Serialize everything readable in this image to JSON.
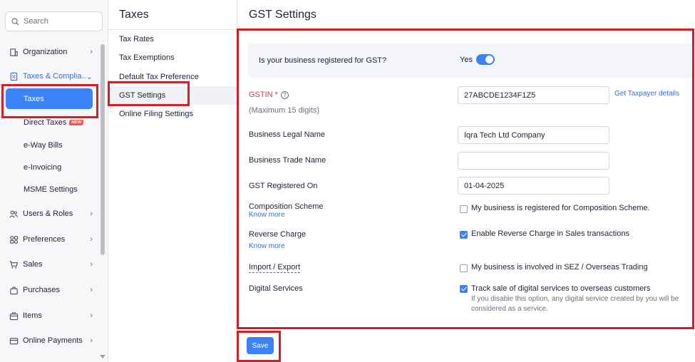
{
  "sidebar": {
    "search_placeholder": "Search",
    "items": [
      {
        "label": "Organization",
        "icon": "building-icon"
      },
      {
        "label": "Taxes & Complia...",
        "icon": "tax-document-icon"
      },
      {
        "label": "Users & Roles",
        "icon": "users-icon"
      },
      {
        "label": "Preferences",
        "icon": "preferences-icon"
      },
      {
        "label": "Sales",
        "icon": "cart-icon"
      },
      {
        "label": "Purchases",
        "icon": "bag-icon"
      },
      {
        "label": "Items",
        "icon": "box-icon"
      },
      {
        "label": "Online Payments",
        "icon": "card-icon"
      }
    ],
    "sub_items": [
      {
        "label": "Taxes"
      },
      {
        "label": "Direct Taxes",
        "badge": "NEW"
      },
      {
        "label": "e-Way Bills"
      },
      {
        "label": "e-Invoicing"
      },
      {
        "label": "MSME Settings"
      }
    ]
  },
  "taxes_menu": {
    "title": "Taxes",
    "items": [
      "Tax Rates",
      "Tax Exemptions",
      "Default Tax Preference",
      "GST Settings",
      "Online Filing Settings"
    ]
  },
  "main": {
    "title": "GST Settings",
    "registered_question": "Is your business registered for GST?",
    "registered_value": "Yes",
    "gstin": {
      "label": "GSTIN *",
      "hint": "(Maximum 15 digits)",
      "value": "27ABCDE1234F1Z5",
      "link": "Get Taxpayer details"
    },
    "legal_name": {
      "label": "Business Legal Name",
      "value": "Iqra Tech Ltd Company"
    },
    "trade_name": {
      "label": "Business Trade Name",
      "value": ""
    },
    "registered_on": {
      "label": "GST Registered On",
      "value": "01-04-2025"
    },
    "composition": {
      "label": "Composition Scheme",
      "link": "Know more",
      "checkbox_label": "My business is registered for Composition Scheme.",
      "checked": false
    },
    "reverse_charge": {
      "label": "Reverse Charge",
      "link": "Know more",
      "checkbox_label": "Enable Reverse Charge in Sales transactions",
      "checked": true
    },
    "import_export": {
      "label": "Import / Export",
      "checkbox_label": "My business is involved in SEZ / Overseas Trading",
      "checked": false
    },
    "digital_services": {
      "label": "Digital Services",
      "checkbox_label": "Track sale of digital services to overseas customers",
      "help": "If you disable this option, any digital service created by you will be considered as a service.",
      "checked": true
    },
    "save_label": "Save"
  },
  "colors": {
    "accent": "#3b82f6",
    "link": "#2f6fd8",
    "required": "#d94040",
    "highlight": "#d11f26"
  }
}
